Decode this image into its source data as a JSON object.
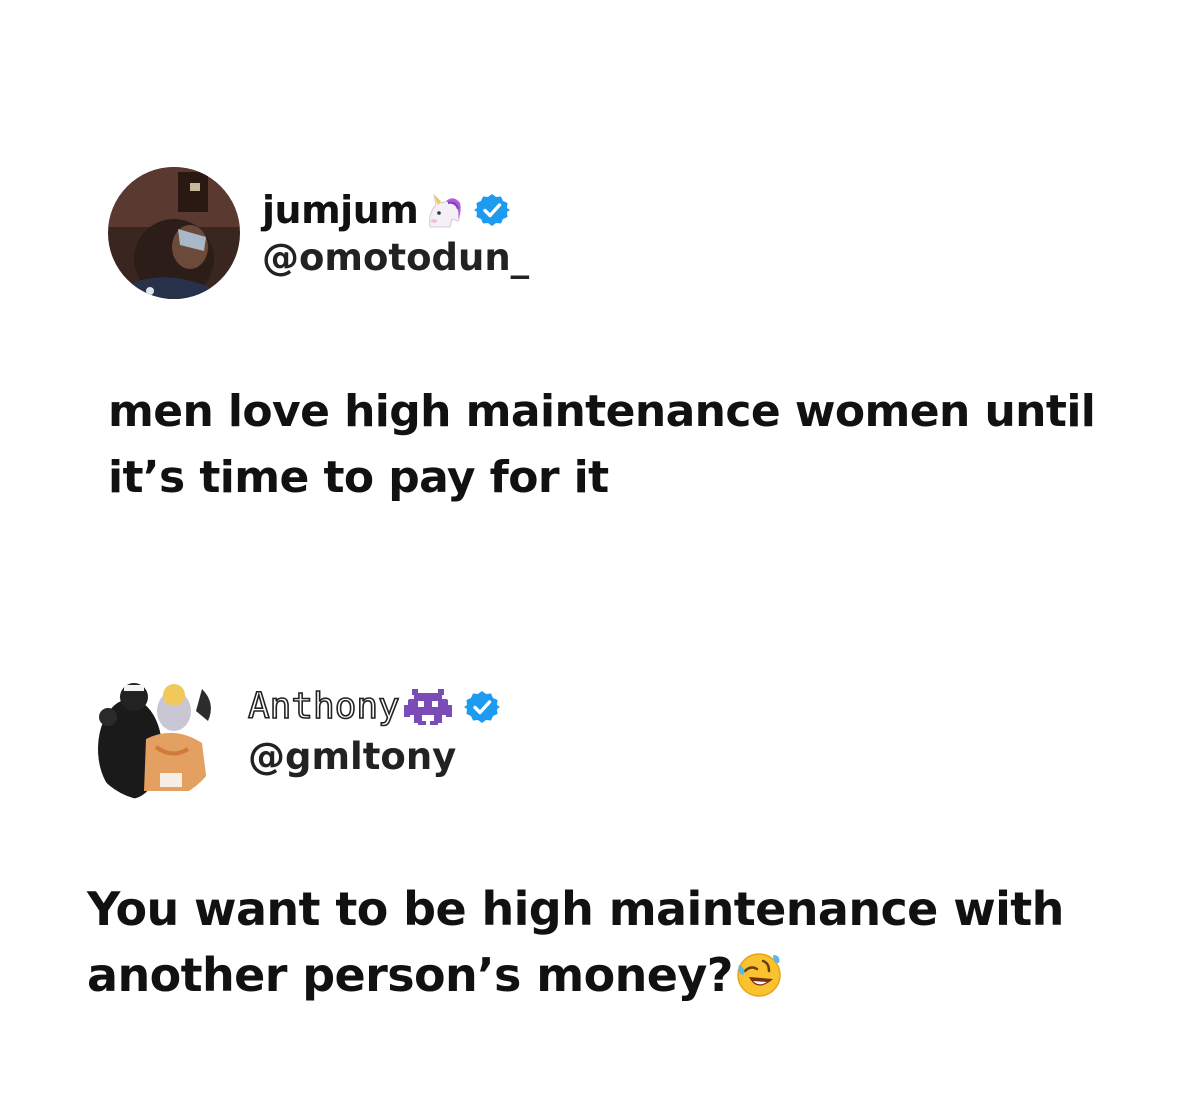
{
  "tweets": [
    {
      "display_name": "jumjum",
      "name_emoji": "unicorn-emoji",
      "verified_icon": "verified-badge-icon",
      "handle": "@omotodun_",
      "text_lines": [
        "men love high maintenance women until",
        "it’s time to pay for it"
      ]
    },
    {
      "display_name": "Anthony",
      "name_emoji": "space-invader-emoji",
      "verified_icon": "verified-badge-icon",
      "handle": "@gmltony",
      "text_lines": [
        "You want to be high maintenance with",
        "another person’s money?"
      ],
      "trailing_emoji": "rolling-on-floor-laughing-emoji"
    }
  ],
  "colors": {
    "verified_blue": "#1d9bf0",
    "text": "#111111",
    "background": "#ffffff"
  }
}
